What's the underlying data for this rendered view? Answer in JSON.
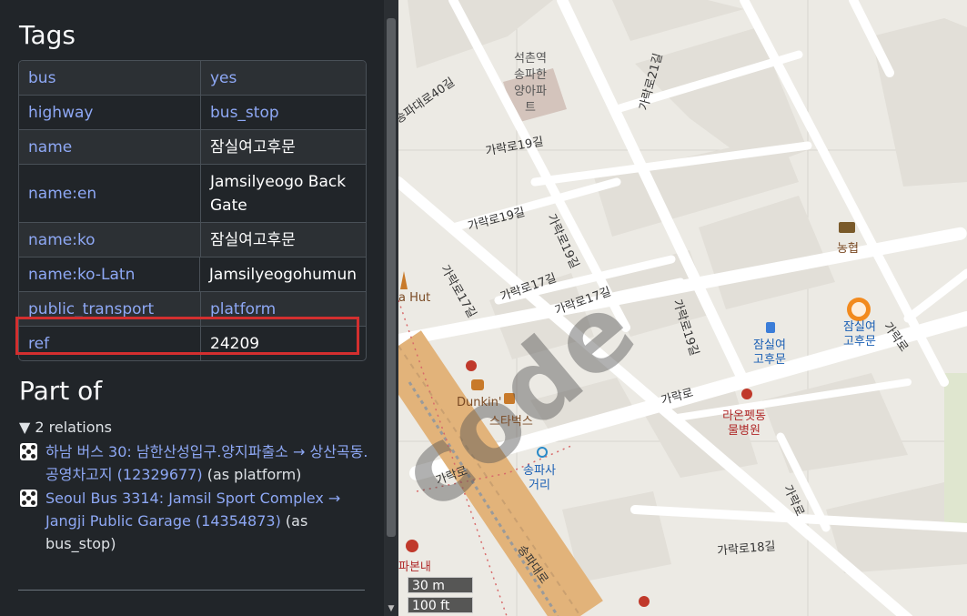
{
  "sidebar": {
    "tags_heading": "Tags",
    "tags": [
      {
        "key": "bus",
        "value": "yes",
        "value_is_link": true
      },
      {
        "key": "highway",
        "value": "bus_stop",
        "value_is_link": true
      },
      {
        "key": "name",
        "value": "잠실여고후문",
        "value_is_link": false
      },
      {
        "key": "name:en",
        "value": "Jamsilyeogo Back Gate",
        "value_is_link": false
      },
      {
        "key": "name:ko",
        "value": "잠실여고후문",
        "value_is_link": false
      },
      {
        "key": "name:ko-Latn",
        "value": "Jamsilyeogohumun",
        "value_is_link": false
      },
      {
        "key": "public_transport",
        "value": "platform",
        "value_is_link": true
      },
      {
        "key": "ref",
        "value": "24209",
        "value_is_link": false
      }
    ],
    "part_of_heading": "Part of",
    "relations_summary": "▼ 2 relations",
    "relations": [
      {
        "link_text": "하남 버스 30: 남한산성입구.양지파출소 → 상산곡동.공영차고지 (12329677)",
        "suffix": " (as platform)"
      },
      {
        "link_text": "Seoul Bus 3314: Jamsil Sport Complex → Jangji Public Garage (14354873)",
        "suffix": " (as bus_stop)"
      }
    ]
  },
  "map": {
    "scale_metric": "30 m",
    "scale_imperial": "100 ft",
    "watermark": "code",
    "labels": [
      {
        "id": "road-garak-21",
        "text": "가락로21길"
      },
      {
        "id": "songpa-daero-40",
        "text": "송파대로40길"
      },
      {
        "id": "seokchon-apt",
        "text": "석촌역 송파한양아파트"
      },
      {
        "id": "road-garak-19-a",
        "text": "가락로19길"
      },
      {
        "id": "road-garak-19-b",
        "text": "가락로19길"
      },
      {
        "id": "road-garak-19-c",
        "text": "가락로19길"
      },
      {
        "id": "road-garak-19-d",
        "text": "가락로19길"
      },
      {
        "id": "road-garak-17-a",
        "text": "가락로17길"
      },
      {
        "id": "road-garak-17-b",
        "text": "가락로17길"
      },
      {
        "id": "road-garak-17-c",
        "text": "가락로17길"
      },
      {
        "id": "nonghyup",
        "text": "농협"
      },
      {
        "id": "pizza-hut",
        "text": "a Hut"
      },
      {
        "id": "busstop-1",
        "text": "잠실여고후문"
      },
      {
        "id": "busstop-2",
        "text": "잠실여고후문"
      },
      {
        "id": "garak-ro-1",
        "text": "가락로"
      },
      {
        "id": "garak-ro-2",
        "text": "가락로"
      },
      {
        "id": "garak-ro-3",
        "text": "가락로"
      },
      {
        "id": "dunkin",
        "text": "Dunkin'"
      },
      {
        "id": "starbucks",
        "text": "스타벅스"
      },
      {
        "id": "raon-animal",
        "text": "라온펫동물병원"
      },
      {
        "id": "songpa-crossroad",
        "text": "송파사거리"
      },
      {
        "id": "songpa-daero",
        "text": "송파대로"
      },
      {
        "id": "road-garak-18",
        "text": "가락로18길"
      },
      {
        "id": "garak-ro-4",
        "text": "가락로"
      },
      {
        "id": "songpa-bonnae",
        "text": "파본내"
      }
    ]
  }
}
